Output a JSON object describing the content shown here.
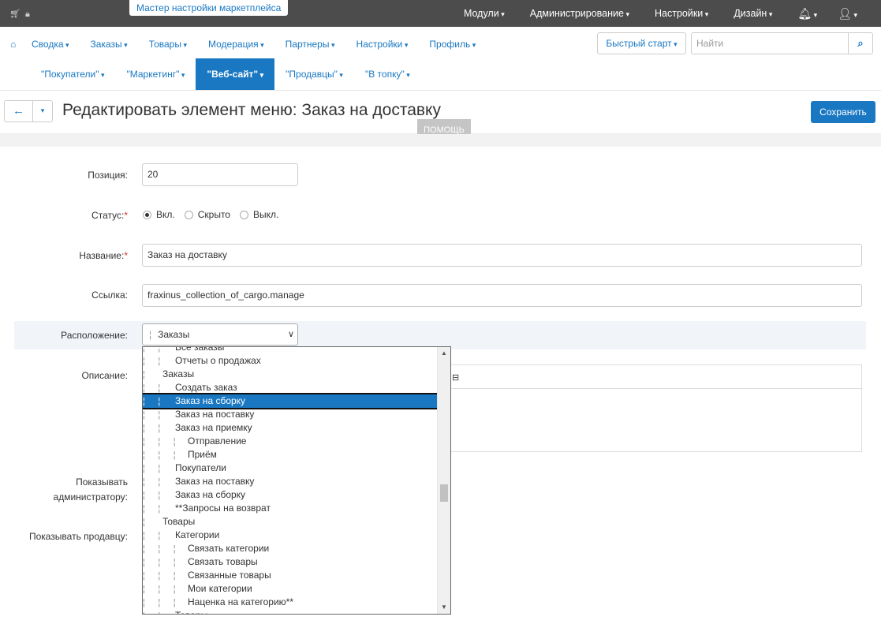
{
  "topbar": {
    "wizard_label": "Мастер настройки маркетплейса",
    "menu": [
      "Модули",
      "Администрирование",
      "Настройки",
      "Дизайн"
    ]
  },
  "mainnav": {
    "row1": [
      "Сводка",
      "Заказы",
      "Товары",
      "Модерация",
      "Партнеры",
      "Настройки",
      "Профиль"
    ],
    "row2": [
      "\"Покупатели\"",
      "\"Маркетинг\"",
      "\"Веб-сайт\"",
      "\"Продавцы\"",
      "\"В топку\""
    ],
    "active_row2": "\"Веб-сайт\"",
    "quick_start": "Быстрый старт",
    "search_placeholder": "Найти"
  },
  "header": {
    "title": "Редактировать элемент меню: Заказ на доставку",
    "save_label": "Сохранить",
    "help_label": "ПОМОЩЬ"
  },
  "form": {
    "position_label": "Позиция:",
    "position_value": "20",
    "status_label": "Статус:",
    "status_options": [
      "Вкл.",
      "Скрыто",
      "Выкл."
    ],
    "status_selected": "Вкл.",
    "name_label": "Название:",
    "name_value": "Заказ на доставку",
    "link_label": "Ссылка:",
    "link_value": "fraxinus_collection_of_cargo.manage",
    "location_label": "Расположение:",
    "location_value": "Заказы",
    "description_label": "Описание:",
    "show_admin_label_1": "Показывать",
    "show_admin_label_2": "администратору:",
    "show_vendor_label": "Показывать продавцу:"
  },
  "dropdown": {
    "items": [
      {
        "label": "Все заказы",
        "level": 2
      },
      {
        "label": "Отчеты о продажах",
        "level": 2
      },
      {
        "label": "Заказы",
        "level": 1
      },
      {
        "label": "Создать заказ",
        "level": 2
      },
      {
        "label": "Заказ на сборку",
        "level": 2,
        "selected": true
      },
      {
        "label": "Заказ на поставку",
        "level": 2
      },
      {
        "label": "Заказ на приемку",
        "level": 2
      },
      {
        "label": "Отправление",
        "level": 3
      },
      {
        "label": "Приём",
        "level": 3
      },
      {
        "label": "Покупатели",
        "level": 2
      },
      {
        "label": "Заказ на поставку",
        "level": 2
      },
      {
        "label": "Заказ на сборку",
        "level": 2
      },
      {
        "label": "**Запросы на возврат",
        "level": 2
      },
      {
        "label": "Товары",
        "level": 1
      },
      {
        "label": "Категории",
        "level": 2
      },
      {
        "label": "Связать категории",
        "level": 3
      },
      {
        "label": "Связать товары",
        "level": 3
      },
      {
        "label": "Связанные товары",
        "level": 3
      },
      {
        "label": "Мои категории",
        "level": 3
      },
      {
        "label": "Наценка на категорию**",
        "level": 3
      },
      {
        "label": "Товары",
        "level": 2
      }
    ]
  }
}
